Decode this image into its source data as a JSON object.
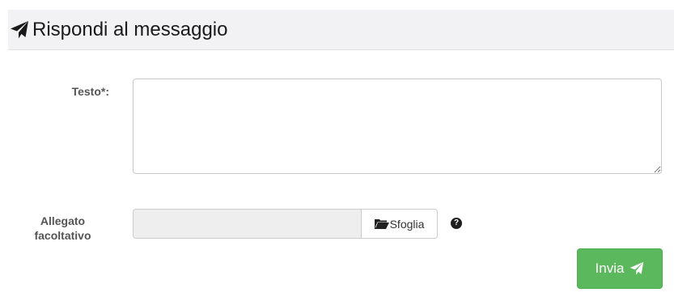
{
  "header": {
    "title": "Rispondi al messaggio",
    "icon": "paper-plane-icon"
  },
  "form": {
    "text_label": "Testo*:",
    "text_value": "",
    "attachment_label_line1": "Allegato",
    "attachment_label_line2": "facoltativo",
    "attachment_value": "",
    "browse_label": "Sfoglia",
    "browse_icon": "folder-open-icon",
    "help_icon": "question-circle-icon",
    "help_glyph": "?"
  },
  "actions": {
    "send_label": "Invia",
    "send_icon": "paper-plane-icon",
    "send_color": "#5cb85c"
  },
  "colors": {
    "header_bg": "#f2f2f4",
    "label_color": "#555555",
    "input_disabled_bg": "#eeeeee"
  }
}
